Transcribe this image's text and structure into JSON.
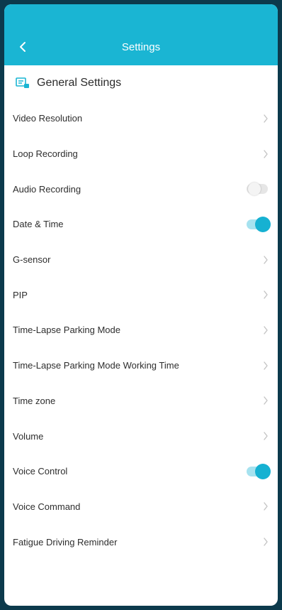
{
  "header": {
    "title": "Settings"
  },
  "section": {
    "title": "General Settings"
  },
  "items": [
    {
      "label": "Video Resolution",
      "control": "chevron"
    },
    {
      "label": "Loop Recording",
      "control": "chevron"
    },
    {
      "label": "Audio Recording",
      "control": "toggle",
      "on": false
    },
    {
      "label": "Date & Time",
      "control": "toggle",
      "on": true
    },
    {
      "label": "G-sensor",
      "control": "chevron"
    },
    {
      "label": "PIP",
      "control": "chevron"
    },
    {
      "label": "Time-Lapse Parking Mode",
      "control": "chevron"
    },
    {
      "label": "Time-Lapse Parking Mode Working Time",
      "control": "chevron"
    },
    {
      "label": "Time zone",
      "control": "chevron"
    },
    {
      "label": "Volume",
      "control": "chevron"
    },
    {
      "label": "Voice Control",
      "control": "toggle",
      "on": true
    },
    {
      "label": "Voice Command",
      "control": "chevron"
    },
    {
      "label": "Fatigue Driving Reminder",
      "control": "chevron"
    }
  ],
  "colors": {
    "accent": "#1ab5d3",
    "background": "#0c3a4c"
  },
  "icons": {
    "back": "chevron-left-icon",
    "section": "settings-card-icon",
    "row": "chevron-right-icon"
  }
}
